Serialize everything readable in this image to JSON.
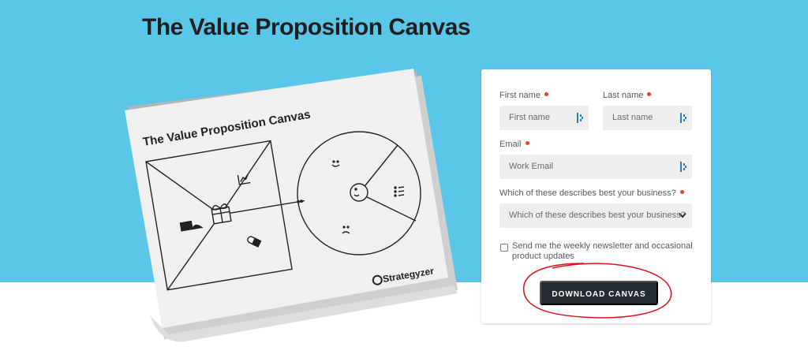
{
  "page": {
    "title": "The Value Proposition Canvas"
  },
  "booklet": {
    "cover_title": "The Value Proposition Canvas",
    "brand": "Strategyzer"
  },
  "form": {
    "first_name": {
      "label": "First name",
      "placeholder": "First name",
      "required": true
    },
    "last_name": {
      "label": "Last name",
      "placeholder": "Last name",
      "required": true
    },
    "email": {
      "label": "Email",
      "placeholder": "Work Email",
      "required": true
    },
    "business": {
      "label": "Which of these describes best your business?",
      "selected": "Which of these describes best your business?",
      "required": true
    },
    "newsletter": {
      "label": "Send me the weekly newsletter and occasional product updates",
      "checked": false
    },
    "submit_label": "DOWNLOAD CANVAS"
  },
  "colors": {
    "hero_background": "#5bc7e8",
    "button_background": "#252b33",
    "required_dot": "#e4412f",
    "annotation_circle": "#e0101a"
  }
}
